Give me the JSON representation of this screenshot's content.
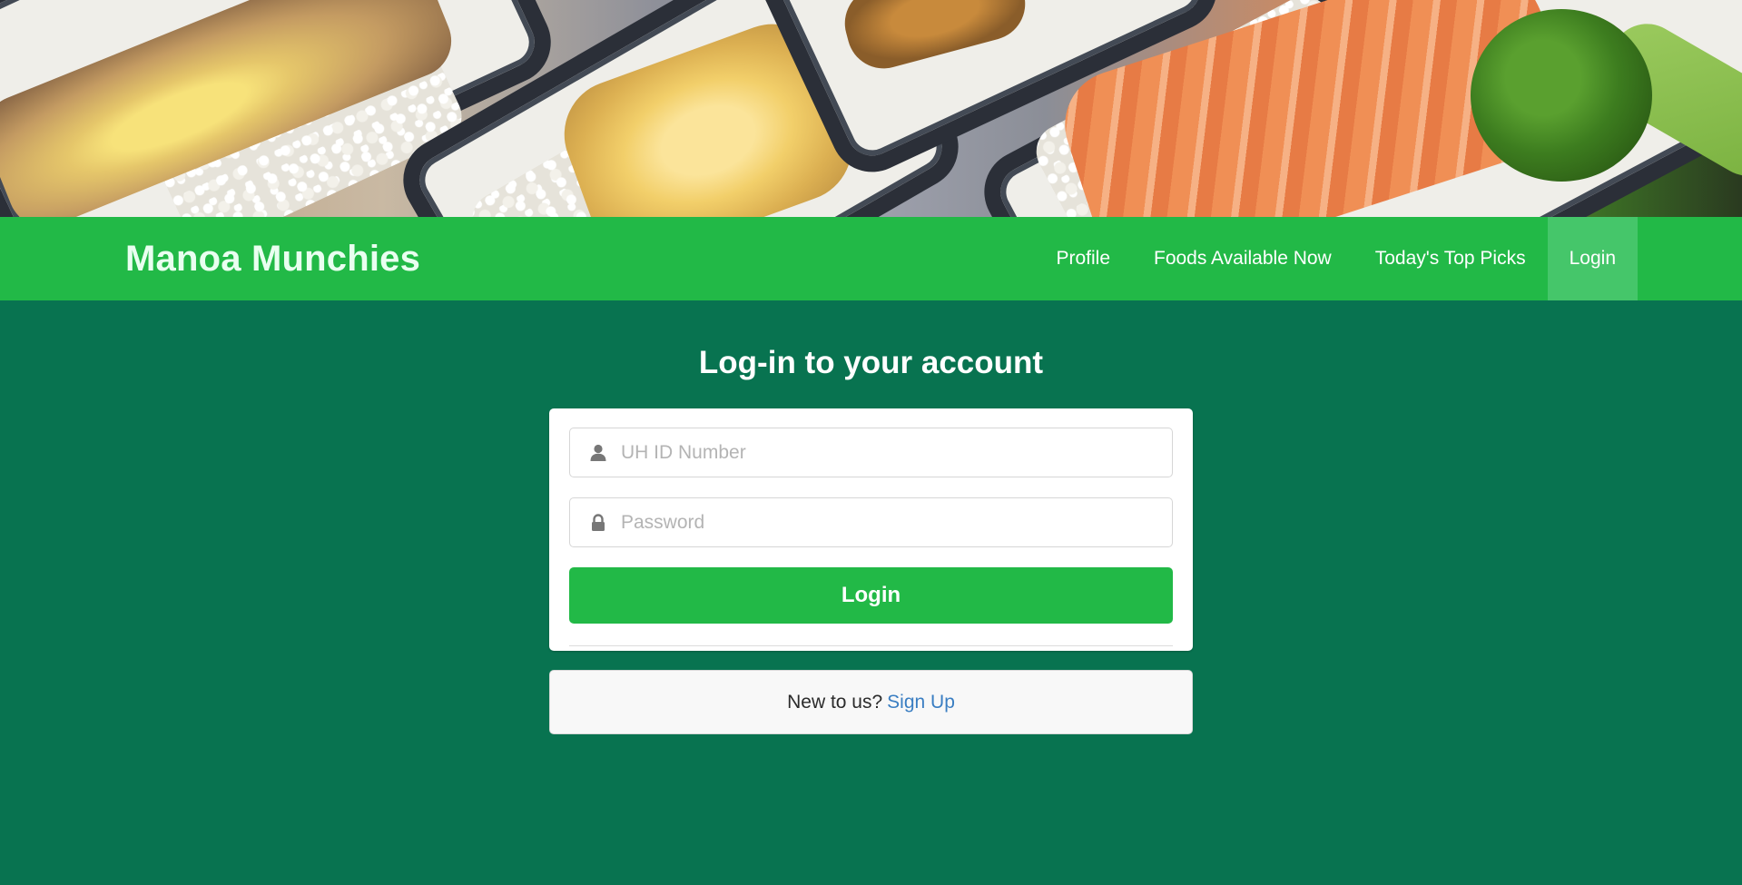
{
  "banner": {
    "image_label": "food-photo-banner"
  },
  "navbar": {
    "brand": "Manoa Munchies",
    "items": [
      {
        "label": "Profile",
        "active": false
      },
      {
        "label": "Foods Available Now",
        "active": false
      },
      {
        "label": "Today's Top Picks",
        "active": false
      },
      {
        "label": "Login",
        "active": true
      }
    ]
  },
  "login": {
    "title": "Log-in to your account",
    "id_field": {
      "placeholder": "UH ID Number",
      "value": "",
      "icon": "user-icon"
    },
    "password_field": {
      "placeholder": "Password",
      "value": "",
      "icon": "lock-icon"
    },
    "submit_label": "Login"
  },
  "signup": {
    "prompt": "New to us?",
    "link_label": "Sign Up"
  },
  "colors": {
    "page_bg": "#087350",
    "navbar_bg": "#22b947",
    "nav_active_bg": "#45c66a",
    "button_bg": "#22b947",
    "link": "#3a7ec2"
  }
}
